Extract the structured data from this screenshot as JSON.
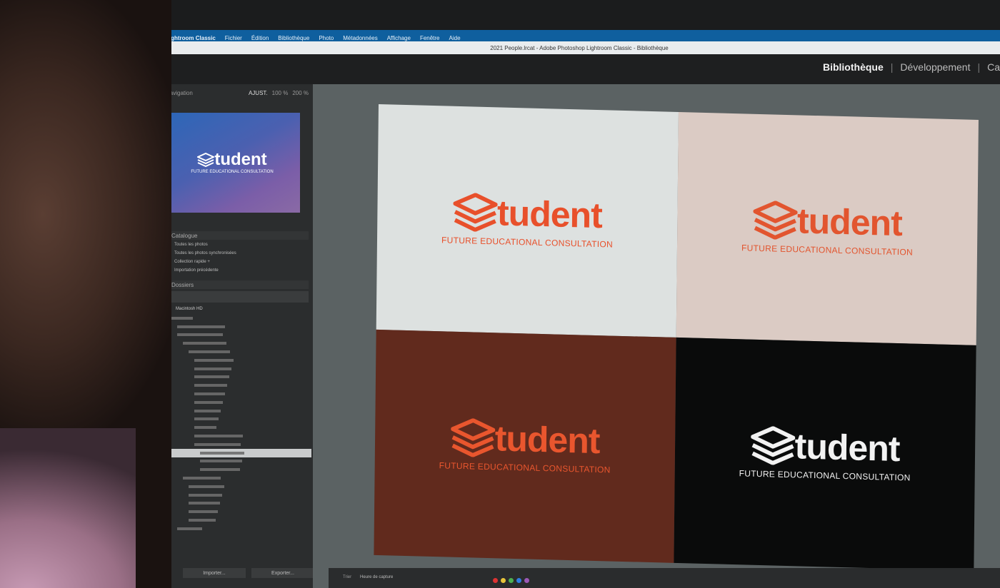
{
  "menu": {
    "app": "Lightroom Classic",
    "items": [
      "Fichier",
      "Édition",
      "Bibliothèque",
      "Photo",
      "Métadonnées",
      "Affichage",
      "Fenêtre",
      "Aide"
    ]
  },
  "window_title": "2021 People.lrcat - Adobe Photoshop Lightroom Classic - Bibliothèque",
  "modules": {
    "library": "Bibliothèque",
    "develop": "Développement",
    "next_partial": "Ca",
    "separator": "|"
  },
  "navigator": {
    "title": "Navigation",
    "zoom_options": [
      "AJUST.",
      "100 %",
      "200 %"
    ]
  },
  "catalog": {
    "title": "Catalogue",
    "rows": [
      {
        "label": "Toutes les photos",
        "count": ""
      },
      {
        "label": "Toutes les photos synchronisées",
        "count": ""
      },
      {
        "label": "Collection rapide +",
        "count": ""
      },
      {
        "label": "Importation précédente",
        "count": ""
      }
    ]
  },
  "folders": {
    "title": "Dossiers",
    "root": "Macintosh HD"
  },
  "left_buttons": {
    "import": "Importer...",
    "export": "Exporter..."
  },
  "logo": {
    "word": "tudent",
    "tagline": "FUTURE EDUCATIONAL CONSULTATION"
  },
  "navigator_logo": {
    "word": "tudent",
    "tagline": "FUTURE EDUCATIONAL CONSULTATION"
  },
  "variants": [
    {
      "name": "light-grey",
      "background": "#dde1e0",
      "ink": "#e8502b"
    },
    {
      "name": "blush",
      "background": "#dbcbc4",
      "ink": "#e2552f"
    },
    {
      "name": "maroon",
      "background": "#612a1d",
      "ink": "#e9562e"
    },
    {
      "name": "black",
      "background": "#0a0b0b",
      "ink": "#f2f2f2"
    }
  ],
  "colors": {
    "menubar": "#0f5f9e",
    "workspace": "#5b6263",
    "panel": "#2b2d2e",
    "brand_orange": "#e8502b"
  },
  "filmstrip_labels": [
    "Trier",
    "Heure de capture"
  ],
  "color_labels": [
    "#d33",
    "#e8c43b",
    "#4caf50",
    "#2f7de1",
    "#9b59b6"
  ]
}
